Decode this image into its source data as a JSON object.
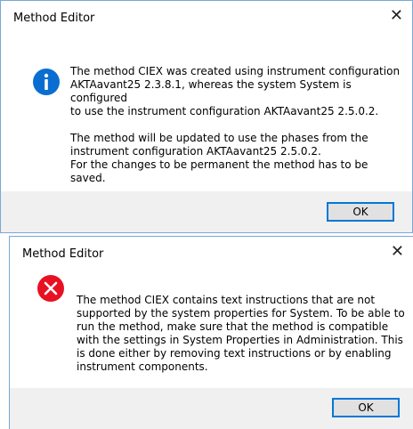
{
  "dialogs": [
    {
      "title": "Method Editor",
      "close_glyph": "✕",
      "icon": "info-icon",
      "paragraphs": [
        "The method CIEX was created using instrument configuration\nAKTAavant25 2.3.8.1, whereas the system System is configured\nto use the instrument configuration AKTAavant25 2.5.0.2.",
        "The method will be updated to use the phases from the\ninstrument configuration AKTAavant25 2.5.0.2.\nFor the changes to be permanent the method has to be\nsaved."
      ],
      "ok_label": "OK"
    },
    {
      "title": "Method Editor",
      "close_glyph": "✕",
      "icon": "error-icon",
      "paragraphs": [
        "The method CIEX contains text instructions that are not\nsupported by the system properties for System. To be able to\nrun the method, make sure that the method is compatible\nwith the settings in System Properties in Administration. This\nis done either by removing text instructions or by enabling\ninstrument components."
      ],
      "ok_label": "OK"
    }
  ],
  "colors": {
    "info_blue": "#0a6ed1",
    "error_red": "#e81123",
    "border": "#7aa7d6",
    "footer": "#f0f0f0",
    "button_accent": "#0078d7"
  }
}
